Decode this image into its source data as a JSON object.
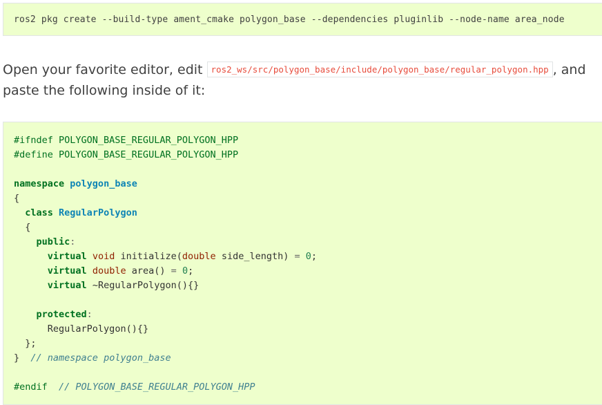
{
  "command": "ros2 pkg create --build-type ament_cmake polygon_base --dependencies pluginlib --node-name area_node",
  "paragraph": {
    "before": "Open your favorite editor, edit ",
    "path": "ros2_ws/src/polygon_base/include/polygon_base/regular_polygon.hpp",
    "after": ", and",
    "line2": "paste the following inside of it:"
  },
  "code": {
    "l1": "#ifndef POLYGON_BASE_REGULAR_POLYGON_HPP",
    "l2": "#define POLYGON_BASE_REGULAR_POLYGON_HPP",
    "namespace_kw": "namespace",
    "namespace_name": "polygon_base",
    "open_brace": "{",
    "class_kw": "class",
    "class_name": "RegularPolygon",
    "public_kw": "public",
    "colon": ":",
    "virtual_kw": "virtual",
    "void_kw": "void",
    "initialize_call": "initialize(",
    "double_kw": "double",
    "side_length_param": "side_length)",
    "equals": "=",
    "zero": "0",
    "semicolon": ";",
    "area_call": "area()",
    "destructor": "~RegularPolygon(){}",
    "protected_kw": "protected",
    "constructor": "RegularPolygon(){}",
    "class_close": "};",
    "close_brace": "}",
    "namespace_comment": "// namespace polygon_base",
    "endif": "#endif",
    "endif_comment": "// POLYGON_BASE_REGULAR_POLYGON_HPP"
  }
}
